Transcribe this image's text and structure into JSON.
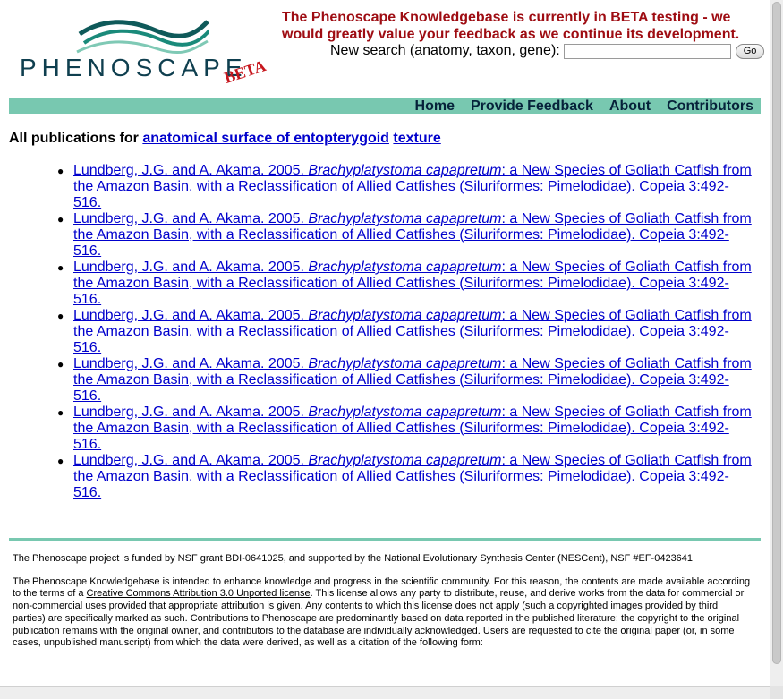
{
  "header": {
    "logo_text": "PHENOSCAPE",
    "logo_beta": "BETA",
    "beta_notice": "The Phenoscape Knowledgebase is currently in BETA testing - we would greatly value your feedback as we continue its development.",
    "search_label": "New search (anatomy, taxon, gene):",
    "search_value": "",
    "go_label": "Go"
  },
  "nav": {
    "home": "Home",
    "feedback": "Provide Feedback",
    "about": "About",
    "contributors": "Contributors"
  },
  "heading": {
    "prefix": "All publications for",
    "entity": "anatomical surface of entopterygoid",
    "quality": "texture"
  },
  "publications": [
    {
      "pre": "Lundberg, J.G. and A. Akama. 2005. ",
      "species": "Brachyplatystoma capapretum",
      "post": ": a New Species of Goliath Catfish from the Amazon Basin, with a Reclassification of Allied Catfishes (Siluriformes: Pimelodidae). Copeia 3:492-516."
    },
    {
      "pre": "Lundberg, J.G. and A. Akama. 2005. ",
      "species": "Brachyplatystoma capapretum",
      "post": ": a New Species of Goliath Catfish from the Amazon Basin, with a Reclassification of Allied Catfishes (Siluriformes: Pimelodidae). Copeia 3:492-516."
    },
    {
      "pre": "Lundberg, J.G. and A. Akama. 2005. ",
      "species": "Brachyplatystoma capapretum",
      "post": ": a New Species of Goliath Catfish from the Amazon Basin, with a Reclassification of Allied Catfishes (Siluriformes: Pimelodidae). Copeia 3:492-516."
    },
    {
      "pre": "Lundberg, J.G. and A. Akama. 2005. ",
      "species": "Brachyplatystoma capapretum",
      "post": ": a New Species of Goliath Catfish from the Amazon Basin, with a Reclassification of Allied Catfishes (Siluriformes: Pimelodidae). Copeia 3:492-516."
    },
    {
      "pre": "Lundberg, J.G. and A. Akama. 2005. ",
      "species": "Brachyplatystoma capapretum",
      "post": ": a New Species of Goliath Catfish from the Amazon Basin, with a Reclassification of Allied Catfishes (Siluriformes: Pimelodidae). Copeia 3:492-516."
    },
    {
      "pre": "Lundberg, J.G. and A. Akama. 2005. ",
      "species": "Brachyplatystoma capapretum",
      "post": ": a New Species of Goliath Catfish from the Amazon Basin, with a Reclassification of Allied Catfishes (Siluriformes: Pimelodidae). Copeia 3:492-516."
    },
    {
      "pre": "Lundberg, J.G. and A. Akama. 2005. ",
      "species": "Brachyplatystoma capapretum",
      "post": ": a New Species of Goliath Catfish from the Amazon Basin, with a Reclassification of Allied Catfishes (Siluriformes: Pimelodidae). Copeia 3:492-516."
    }
  ],
  "footer": {
    "funding": "The Phenoscape project is funded by NSF grant BDI-0641025, and supported by the National Evolutionary Synthesis Center (NESCent), NSF #EF-0423641",
    "license_pre": "The Phenoscape Knowledgebase is intended to enhance knowledge and progress in the scientific community. For this reason, the contents are made available according to the terms of a ",
    "license_link": "Creative Commons Attribution 3.0 Unported license",
    "license_post": ". This license allows any party to distribute, reuse, and derive works from the data for commercial or non-commercial uses provided that appropriate attribution is given. Any contents to which this license does not apply (such a copyrighted images provided by third parties) are specifically marked as such. Contributions to Phenoscape are predominantly based on data reported in the published literature; the copyright to the original publication remains with the original owner, and contributors to the database are individually acknowledged. Users are requested to cite the original paper (or, in some cases, unpublished manuscript) from which the data were derived, as well as a citation of the following form:"
  },
  "colors": {
    "nav_bar": "#78c8b0",
    "beta_notice": "#9e0c12",
    "link": "#0000cc",
    "logo_text": "#0f3f4f"
  }
}
